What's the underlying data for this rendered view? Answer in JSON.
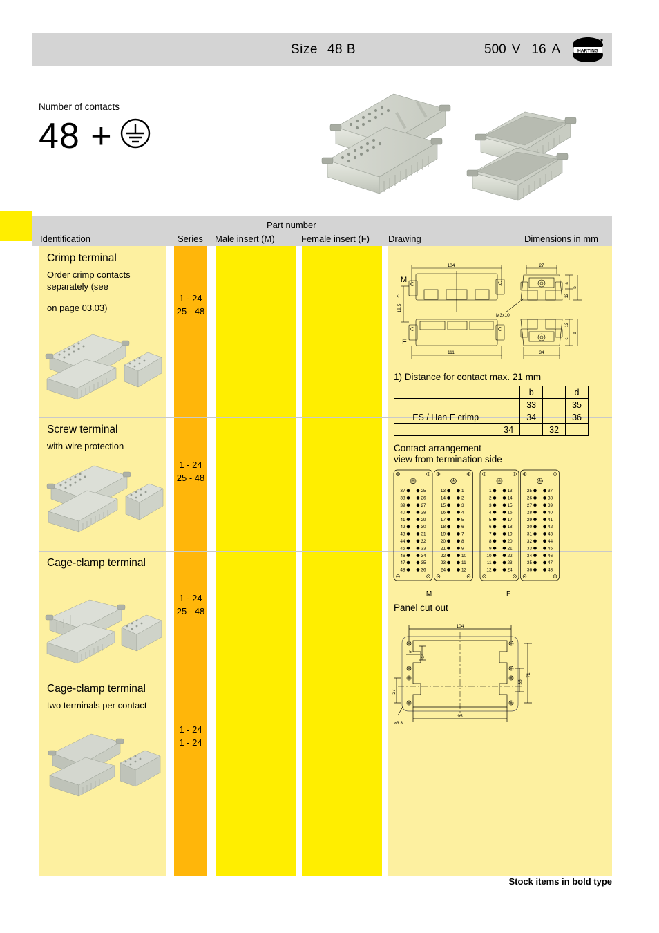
{
  "header": {
    "size_label": "Size",
    "size_value": "48 B",
    "voltage": "500",
    "voltage_unit": "V",
    "current": "16",
    "current_unit": "A",
    "brand": "HARTING"
  },
  "intro": {
    "contacts_label": "Number of contacts",
    "contacts_count": "48 +",
    "earth_symbol": "earth-ground-icon"
  },
  "table_header": {
    "identification": "Identification",
    "series": "Series",
    "part_number": "Part number",
    "male_insert": "Male insert (M)",
    "female_insert": "Female insert (F)",
    "drawing": "Drawing",
    "dimensions": "Dimensions in mm"
  },
  "rows": [
    {
      "title": "Crimp terminal",
      "sub1": "Order crimp contacts",
      "sub2": "separately (see",
      "sub3": "on page 03.03)",
      "series1": "1 - 24",
      "series2": "25 - 48",
      "male": "",
      "female": ""
    },
    {
      "title": "Screw terminal",
      "sub1": "with wire protection",
      "sub2": "",
      "sub3": "",
      "series1": "1 - 24",
      "series2": "25 - 48",
      "male": "",
      "female": ""
    },
    {
      "title": "Cage-clamp terminal",
      "sub1": "",
      "sub2": "",
      "sub3": "",
      "series1": "1 - 24",
      "series2": "25 - 48",
      "male": "",
      "female": ""
    },
    {
      "title": "Cage-clamp terminal",
      "sub1": "two terminals per contact",
      "sub2": "",
      "sub3": "",
      "series1": "1 - 24",
      "series2": "1 - 24",
      "male": "",
      "female": ""
    }
  ],
  "drawing": {
    "label_m": "M",
    "label_f": "F",
    "dim_104": "104",
    "dim_111": "111",
    "dim_27": "27",
    "dim_34": "34",
    "dim_195": "19.5",
    "dim_195_sup": "1)",
    "thread": "M3x10",
    "dim_12_top": "12",
    "dim_12_bot": "12",
    "letter_a": "a",
    "letter_b": "b",
    "letter_c": "c",
    "letter_d": "d"
  },
  "footnote": "1) Distance for contact max. 21 mm",
  "dim_table": {
    "headers": [
      "",
      "",
      "b",
      "",
      "d"
    ],
    "rows": [
      [
        "",
        "",
        "33",
        "",
        "35"
      ],
      [
        "ES / Han E   crimp",
        "",
        "34",
        "",
        "36"
      ],
      [
        "",
        "34",
        "",
        "32",
        ""
      ]
    ]
  },
  "contact_arrangement": {
    "title_line1": "Contact arrangement",
    "title_line2": "view from termination side",
    "label_m": "M",
    "label_f": "F",
    "panels": [
      {
        "left": [
          "37",
          "38",
          "39",
          "40",
          "41",
          "42",
          "43",
          "44",
          "45",
          "46",
          "47",
          "48"
        ],
        "right": [
          "25",
          "26",
          "27",
          "28",
          "29",
          "30",
          "31",
          "32",
          "33",
          "34",
          "35",
          "36"
        ]
      },
      {
        "left": [
          "13",
          "14",
          "15",
          "16",
          "17",
          "18",
          "19",
          "20",
          "21",
          "22",
          "23",
          "24"
        ],
        "right": [
          "1",
          "2",
          "3",
          "4",
          "5",
          "6",
          "7",
          "8",
          "9",
          "10",
          "11",
          "12"
        ]
      },
      {
        "left": [
          "1",
          "2",
          "3",
          "4",
          "5",
          "6",
          "7",
          "8",
          "9",
          "10",
          "11",
          "12"
        ],
        "right": [
          "13",
          "14",
          "15",
          "16",
          "17",
          "18",
          "19",
          "20",
          "21",
          "22",
          "23",
          "24"
        ]
      },
      {
        "left": [
          "25",
          "26",
          "27",
          "28",
          "29",
          "30",
          "31",
          "32",
          "33",
          "34",
          "35",
          "36"
        ],
        "right": [
          "37",
          "38",
          "39",
          "40",
          "41",
          "42",
          "43",
          "44",
          "45",
          "46",
          "47",
          "48"
        ]
      }
    ]
  },
  "panel_cutout": {
    "title": "Panel cut out",
    "dim_104": "104",
    "dim_95": "95",
    "dim_71": "71",
    "dim_35": "35",
    "dim_27": "27",
    "dim_14": "14",
    "dim_5": "5",
    "dim_hole": "ø3.3"
  },
  "footer": {
    "note": "Stock items in bold type"
  },
  "colors": {
    "header_grey": "#d4d4d4",
    "tab_yellow": "#ffee00",
    "light_yellow": "#fdf0a0",
    "orange": "#ffb60a",
    "bright_yellow": "#ffee00"
  }
}
